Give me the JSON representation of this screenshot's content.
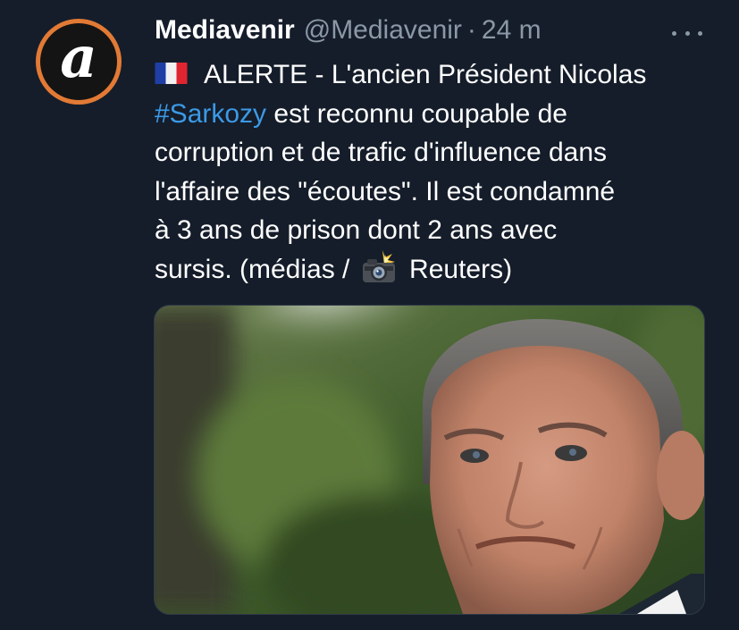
{
  "tweet": {
    "display_name": "Mediavenir",
    "handle": "@Mediavenir",
    "separator": "·",
    "time": "24 m",
    "avatar_letter": "a",
    "more_icon": "ellipsis-icon",
    "text": {
      "line1_rest": "ALERTE - L'ancien Président Nicolas",
      "hashtag": "#Sarkozy",
      "line2_rest": " est reconnu coupable de",
      "line3": "corruption et de trafic d'influence dans",
      "line4": "l'affaire des \"écoutes\". Il est condamné",
      "line5": "à 3 ans de prison dont 2 ans avec",
      "line6_start": "sursis. (médias / ",
      "line6_end": " Reuters)"
    },
    "emojis": {
      "flag": "france-flag-icon",
      "camera": "camera-flash-icon"
    },
    "media": {
      "type": "photo"
    }
  },
  "colors": {
    "background": "#151d2a",
    "text": "#ffffff",
    "muted": "#8b98a5",
    "link": "#3b9ae6",
    "avatar_ring": "#e27a35"
  }
}
